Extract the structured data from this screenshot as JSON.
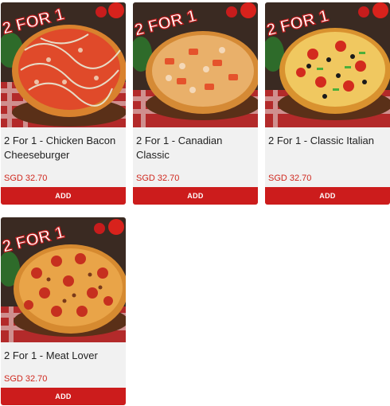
{
  "products": [
    {
      "title": "2 For 1 - Chicken Bacon Cheeseburger",
      "price": "SGD 32.70",
      "button": "ADD",
      "promo": "2 FOR 1",
      "pizza": "chicken-bacon-cheeseburger"
    },
    {
      "title": "2 For 1 - Canadian Classic",
      "price": "SGD 32.70",
      "button": "ADD",
      "promo": "2 FOR 1",
      "pizza": "canadian-classic"
    },
    {
      "title": "2 For 1 - Classic Italian",
      "price": "SGD 32.70",
      "button": "ADD",
      "promo": "2 FOR 1",
      "pizza": "classic-italian"
    },
    {
      "title": "2 For 1 - Meat Lover",
      "price": "SGD 32.70",
      "button": "ADD",
      "promo": "2 FOR 1",
      "pizza": "meat-lover"
    }
  ],
  "colors": {
    "accent": "#cc1c1c",
    "price": "#d0281e",
    "card_bg": "#f1f1f1"
  }
}
